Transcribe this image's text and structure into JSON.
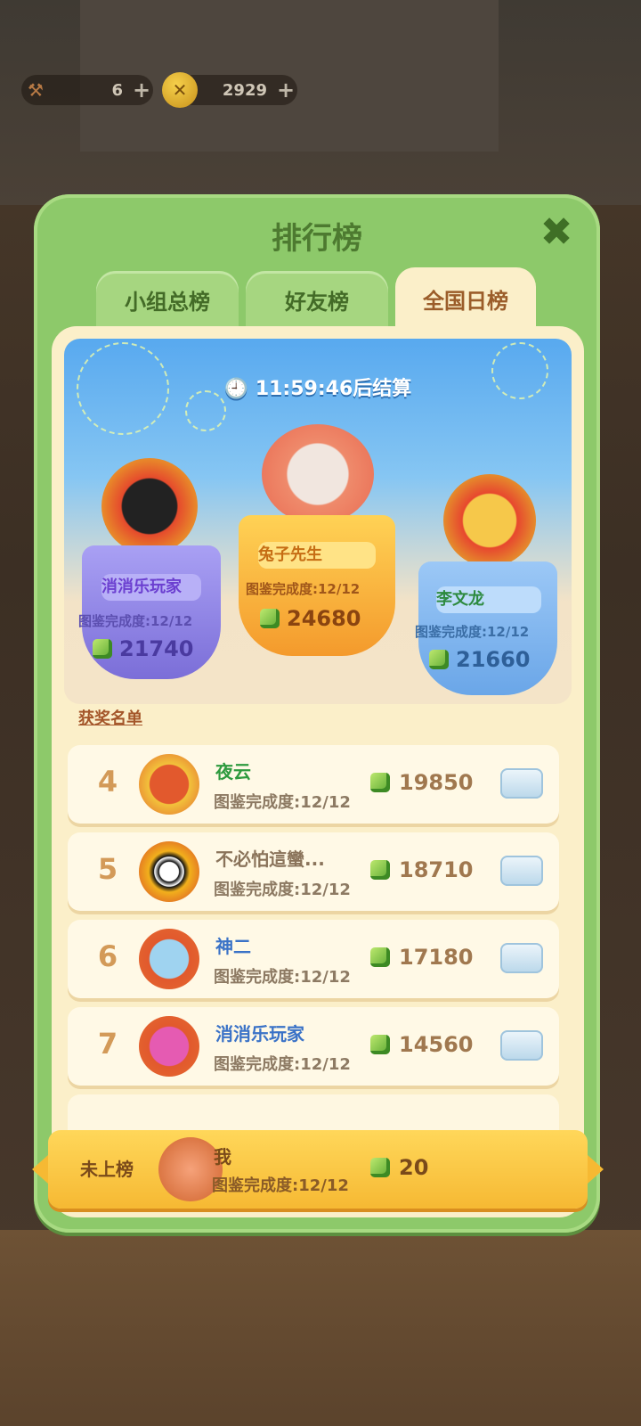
{
  "resources": {
    "items": [
      {
        "icon": "hammer-icon",
        "value": "6",
        "plus": "+"
      },
      {
        "icon": "coin-icon",
        "value": "2929",
        "plus": "+"
      }
    ]
  },
  "dialog": {
    "title": "排行榜",
    "close_icon": "close-icon"
  },
  "tabs": [
    {
      "label": "小组总榜",
      "active": false
    },
    {
      "label": "好友榜",
      "active": false
    },
    {
      "label": "全国日榜",
      "active": true
    }
  ],
  "timer": "11:59:46后结算",
  "podium": {
    "first": {
      "name": "兔子先生",
      "completion": "图鉴完成度:12/12",
      "score": "24680"
    },
    "second": {
      "name": "消消乐玩家",
      "completion": "图鉴完成度:12/12",
      "score": "21740"
    },
    "third": {
      "name": "李文龙",
      "completion": "图鉴完成度:12/12",
      "score": "21660"
    }
  },
  "winners_label": "获奖名单",
  "rows": [
    {
      "rank": "4",
      "name": "夜云",
      "completion": "图鉴完成度:12/12",
      "score": "19850"
    },
    {
      "rank": "5",
      "name": "不必怕這蠻...",
      "completion": "图鉴完成度:12/12",
      "score": "18710"
    },
    {
      "rank": "6",
      "name": "神二",
      "completion": "图鉴完成度:12/12",
      "score": "17180"
    },
    {
      "rank": "7",
      "name": "消消乐玩家",
      "completion": "图鉴完成度:12/12",
      "score": "14560"
    }
  ],
  "me": {
    "status": "未上榜",
    "name": "我",
    "completion": "图鉴完成度:12/12",
    "score": "20"
  },
  "colors": {
    "panel_green": "#8dc96a",
    "gold": "#f6b933",
    "purple": "#8f86e6",
    "orange": "#f7a630",
    "blue": "#6aa6e8"
  }
}
